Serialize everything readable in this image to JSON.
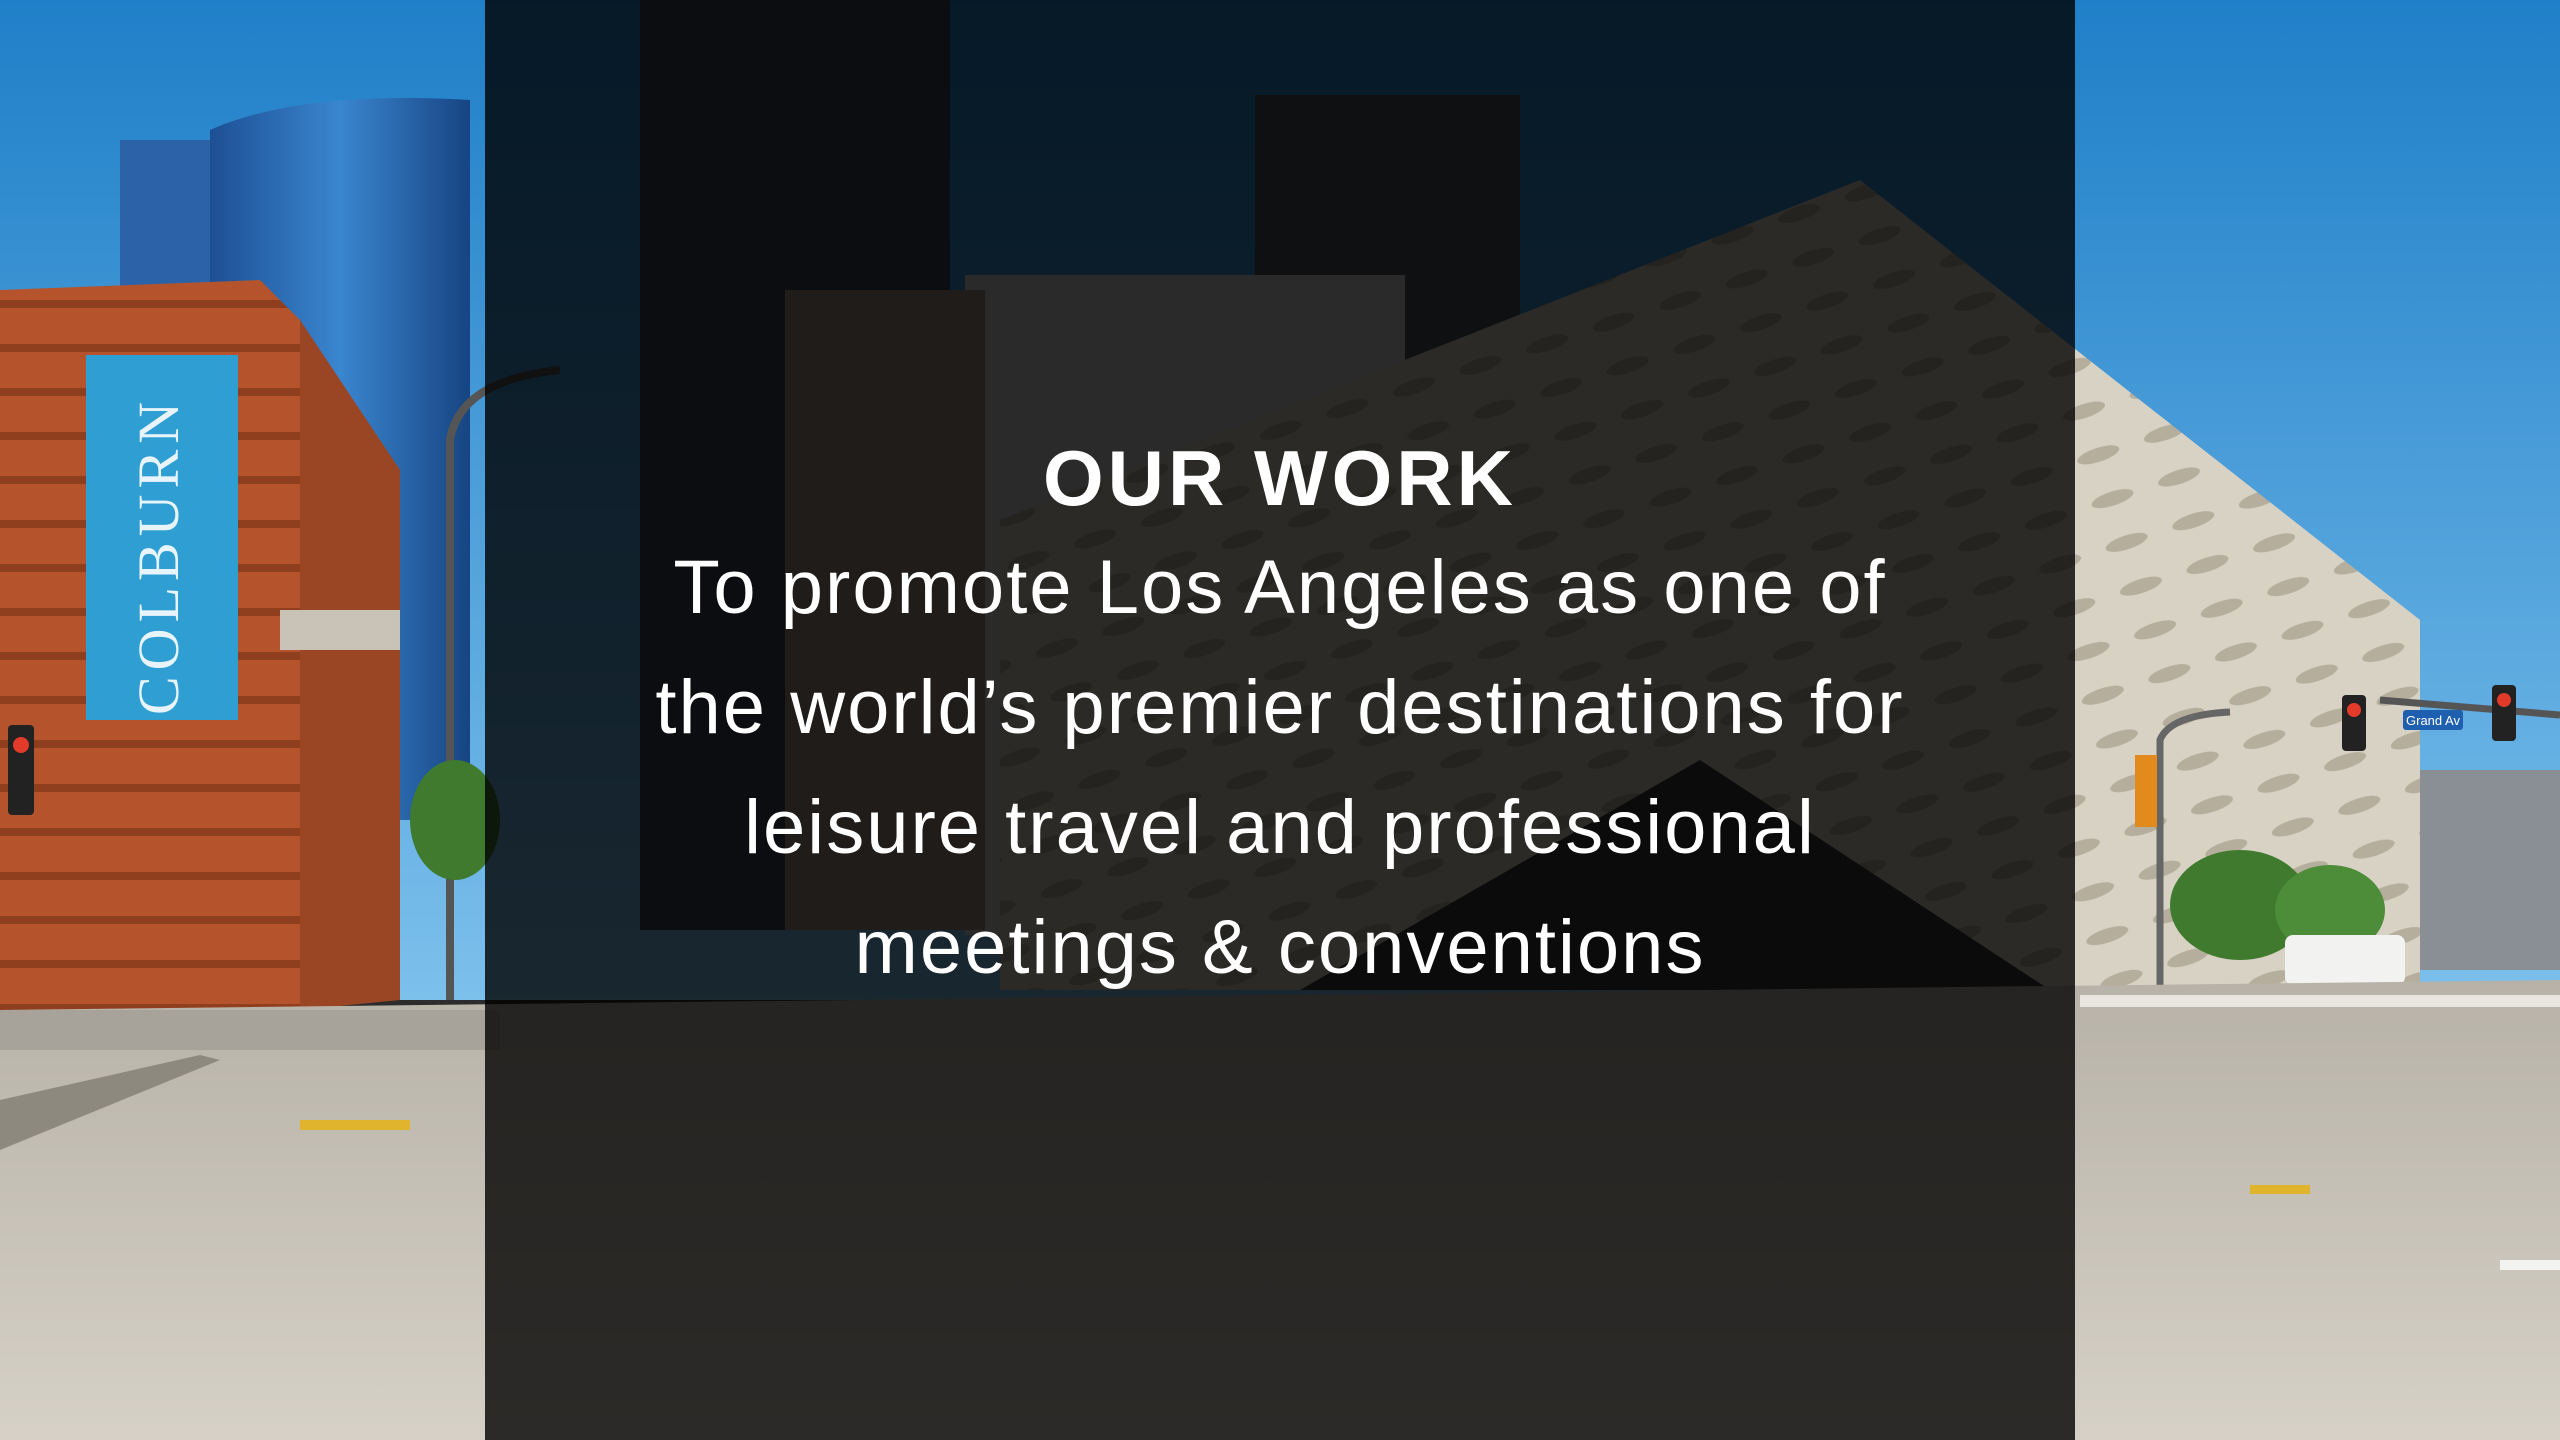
{
  "slide": {
    "heading": "OUR WORK",
    "mission_lines": [
      "To promote Los Angeles as one of",
      "the world’s premier destinations for",
      "leisure travel and professional",
      "meetings & conventions"
    ],
    "overlay_color": "#000000",
    "text_color": "#ffffff"
  },
  "photo": {
    "colburn_banner_text": "COLBURN",
    "street_sign_text": "Grand Av",
    "colors": {
      "sky": "#3f9bd8",
      "brick": "#b5542c",
      "banner": "#2f9fd3",
      "glass_tower": "#2a6fb8",
      "museum_facade": "#d8d2c4",
      "street": "#c9c4b8"
    }
  }
}
